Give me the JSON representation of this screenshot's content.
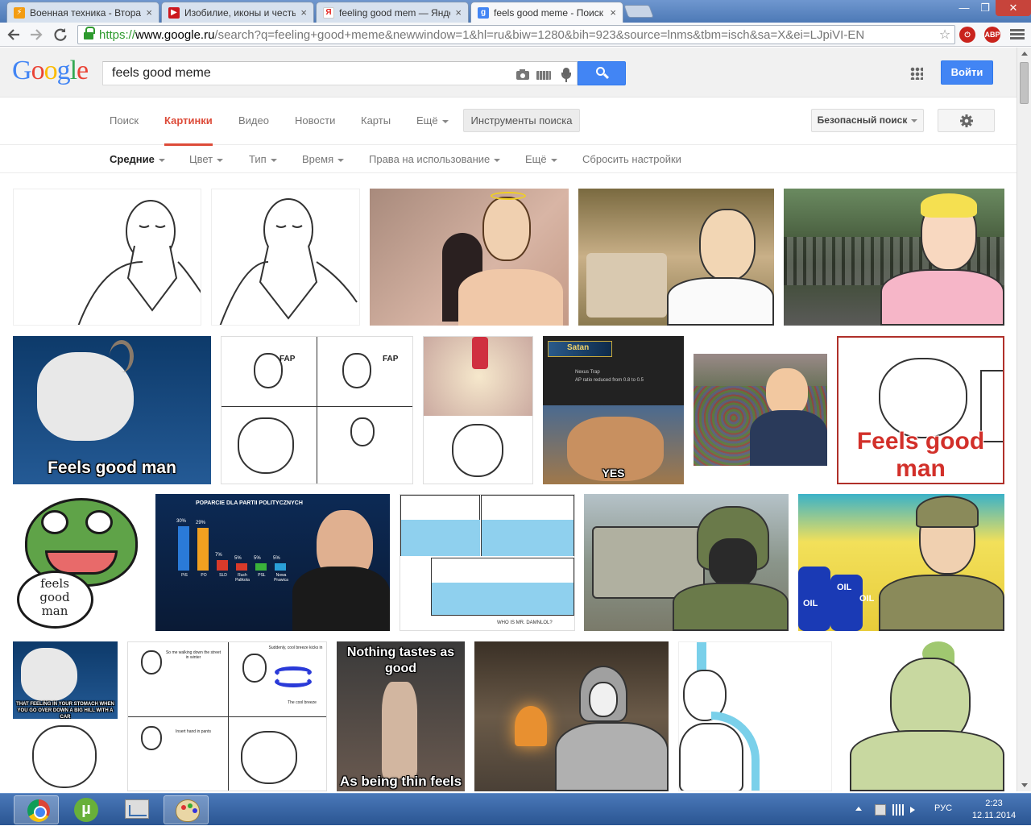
{
  "browser": {
    "tabs": [
      {
        "title": "Военная техника - Вторая мировая",
        "favicon_color": "#f39c12",
        "favicon_glyph": "⚡"
      },
      {
        "title": "Изобилие, иконы и честь",
        "favicon_color": "#cc181e",
        "favicon_glyph": "▶"
      },
      {
        "title": "feeling good mem — Яндекс",
        "favicon_color": "#ffffff",
        "favicon_glyph": "Я"
      },
      {
        "title": "feels good meme - Поиск в Google",
        "favicon_color": "#4285f4",
        "favicon_glyph": "g"
      }
    ],
    "active_tab_index": 3,
    "close_glyph": "×",
    "url_scheme": "https://",
    "url_host": "www.google.ru",
    "url_rest": "/search?q=feeling+good+meme&newwindow=1&hl=ru&biw=1280&bih=923&source=lnms&tbm=isch&sa=X&ei=LJpiVI-EN",
    "ext_abp_label": "ABP",
    "window_buttons": {
      "minimize": "—",
      "maximize": "❐",
      "close": "✕"
    }
  },
  "google": {
    "logo": [
      "G",
      "o",
      "o",
      "g",
      "l",
      "e"
    ],
    "query": "feels good meme",
    "signin_label": "Войти",
    "tabs": [
      {
        "label": "Поиск",
        "selected": false,
        "dropdown": false
      },
      {
        "label": "Картинки",
        "selected": true,
        "dropdown": false
      },
      {
        "label": "Видео",
        "selected": false,
        "dropdown": false
      },
      {
        "label": "Новости",
        "selected": false,
        "dropdown": false
      },
      {
        "label": "Карты",
        "selected": false,
        "dropdown": false
      },
      {
        "label": "Ещё",
        "selected": false,
        "dropdown": true
      }
    ],
    "tools_label": "Инструменты поиска",
    "safesearch_label": "Безопасный поиск",
    "filters": [
      {
        "label": "Средние",
        "selected": true,
        "dropdown": true
      },
      {
        "label": "Цвет",
        "selected": false,
        "dropdown": true
      },
      {
        "label": "Тип",
        "selected": false,
        "dropdown": true
      },
      {
        "label": "Время",
        "selected": false,
        "dropdown": true
      },
      {
        "label": "Права на использование",
        "selected": false,
        "dropdown": true
      },
      {
        "label": "Ещё",
        "selected": false,
        "dropdown": true
      },
      {
        "label": "Сбросить настройки",
        "selected": false,
        "dropdown": false
      }
    ]
  },
  "images": {
    "captions": {
      "goat_main": "Feels good man",
      "smug_main": "Feels good man",
      "pepe_text": "feels\ngood\nman",
      "yes_text": "YES",
      "game_title": "Satan",
      "game_item": "Nexus Trap",
      "game_desc": "AP ratio reduced from 0.8 to 0.5",
      "chart_title": "POPARCIE DLA PARTII POLITYCZNYCH",
      "chart_values": [
        "30%",
        "29%",
        "7%",
        "5%",
        "5%",
        "5%"
      ],
      "chart_parties": [
        "PiS",
        "PO",
        "SLD",
        "Ruch Palikota",
        "PSL",
        "Nowa Prawica"
      ],
      "oil_1": "OIL",
      "oil_2": "OIL",
      "oil_3": "OIL",
      "swim_caption": "WHO IS MR. DAMNLOL?",
      "goat_small": "THAT FEELING IN YOUR STOMACH WHEN YOU GO OVER DOWN A BIG HILL WITH A CAR",
      "comic_text_1": "So me walking down the street in winter",
      "comic_text_2": "Suddenly, cool breeze kicks in",
      "comic_text_3": "The cool breeze",
      "comic_text_4": "Insert hand in pants",
      "thin_top": "Nothing tastes as good",
      "thin_bottom": "As being thin feels",
      "fap": "FAP"
    }
  },
  "taskbar": {
    "lang": "РУС",
    "time": "2:23",
    "date": "12.11.2014",
    "utorrent_glyph": "µ"
  }
}
